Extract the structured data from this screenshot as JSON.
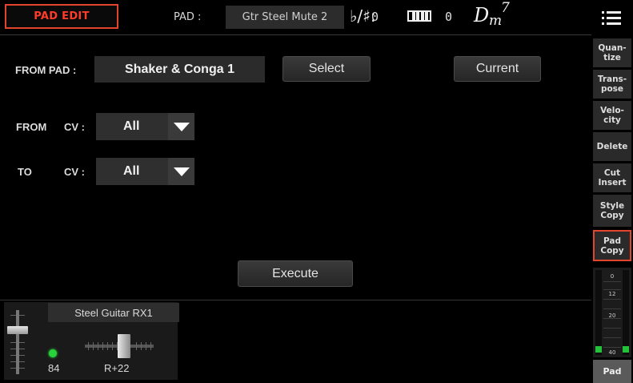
{
  "header": {
    "mode": "PAD EDIT",
    "pad_label": "PAD :",
    "pad_name": "Gtr Steel Mute 2",
    "accidental_symbol": "♭/♯:",
    "accidental_value": "0",
    "transpose_icon": "keyboard-icon",
    "transpose_value": "0",
    "chord": {
      "root": "D",
      "quality": "m",
      "extension": "7"
    },
    "menu_icon": "menu-icon"
  },
  "form": {
    "from_pad_label": "FROM PAD :",
    "from_pad_value": "Shaker & Conga 1",
    "select_button": "Select",
    "current_button": "Current",
    "from_label": "FROM",
    "from_cv_label": "CV :",
    "from_cv_value": "All",
    "to_label": "TO",
    "to_cv_label": "CV :",
    "to_cv_value": "All",
    "execute_button": "Execute"
  },
  "track": {
    "name": "Steel Guitar RX1",
    "velocity": "84",
    "pan": "R+22",
    "volume_level": 0.72,
    "pan_position": 0.59,
    "led_color": "#27d43a"
  },
  "sidebar": {
    "items": [
      {
        "label": "Quan-\ntize",
        "active": false
      },
      {
        "label": "Trans-\npose",
        "active": false
      },
      {
        "label": "Velo-\ncity",
        "active": false
      },
      {
        "label": "Delete",
        "active": false
      },
      {
        "label": "Cut\nInsert",
        "active": false
      },
      {
        "label": "Style\nCopy",
        "active": false
      },
      {
        "label": "Pad\nCopy",
        "active": true
      }
    ],
    "meter_scale": [
      "0",
      "12",
      "20",
      "40"
    ],
    "bottom_tab": "Pad"
  },
  "colors": {
    "accent": "#e2442c",
    "meter_green": "#24c23a",
    "background": "#000000"
  }
}
